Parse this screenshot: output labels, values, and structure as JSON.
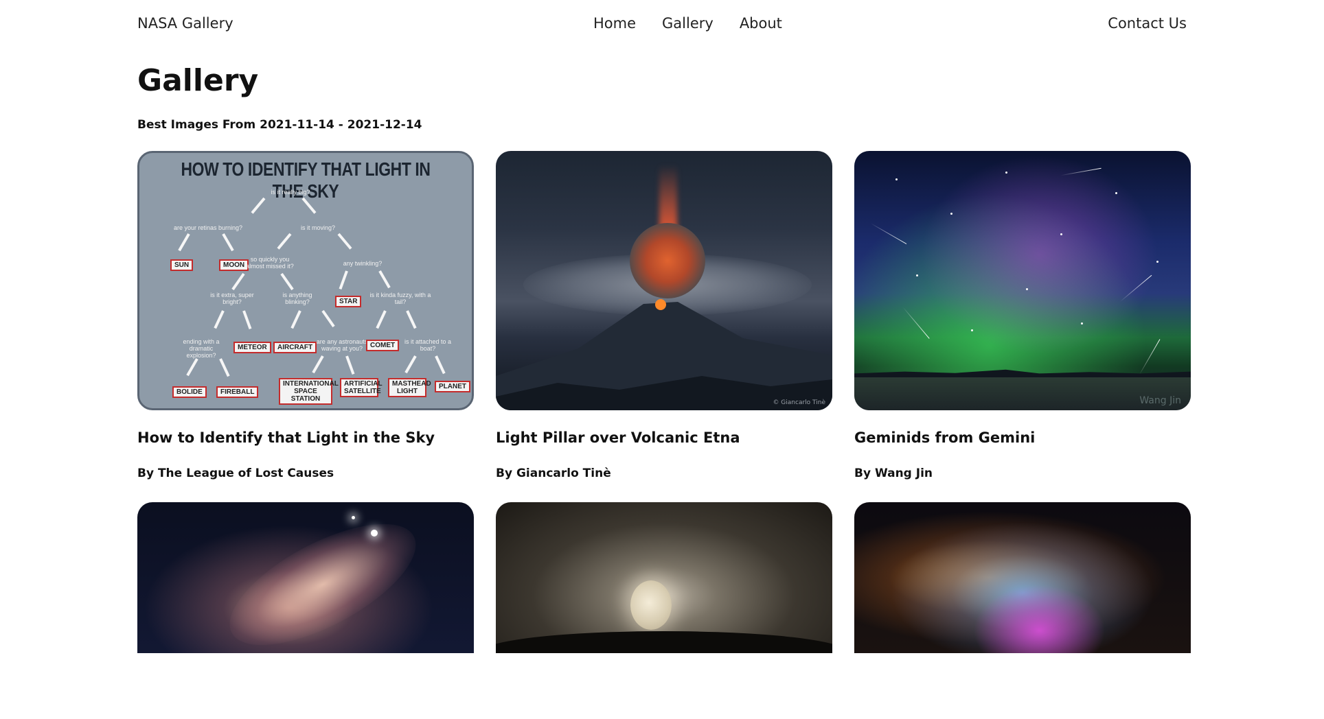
{
  "header": {
    "brand": "NASA Gallery",
    "nav": [
      "Home",
      "Gallery",
      "About"
    ],
    "contact": "Contact Us"
  },
  "page": {
    "title": "Gallery",
    "range": "Best Images From 2021-11-14 - 2021-12-14"
  },
  "cards": [
    {
      "title": "How to Identify that Light in the Sky",
      "by": "By The League of Lost Causes"
    },
    {
      "title": "Light Pillar over Volcanic Etna",
      "by": "By Giancarlo Tinè"
    },
    {
      "title": "Geminids from Gemini",
      "by": "By Wang Jin"
    },
    {
      "title": "",
      "by": ""
    },
    {
      "title": "",
      "by": ""
    },
    {
      "title": "",
      "by": ""
    }
  ],
  "image1": {
    "heading": "HOW TO IDENTIFY THAT LIGHT IN THE SKY",
    "questions": [
      "is it really big?",
      "are your retinas burning?",
      "is it moving?",
      "so quickly you almost missed it?",
      "any twinkling?",
      "is it extra, super bright?",
      "is anything blinking?",
      "is it kinda fuzzy, with a tail?",
      "ending with a dramatic explosion?",
      "are any astronauts waving at you?",
      "is it attached to a boat?"
    ],
    "answers": [
      "SUN",
      "MOON",
      "STAR",
      "METEOR",
      "AIRCRAFT",
      "COMET",
      "BOLIDE",
      "FIREBALL",
      "INTERNATIONAL SPACE STATION",
      "ARTIFICIAL SATELLITE",
      "MASTHEAD LIGHT",
      "PLANET"
    ]
  },
  "image2": {
    "credit": "© Giancarlo Tinè"
  },
  "image3": {
    "credit": "Wang Jin"
  }
}
